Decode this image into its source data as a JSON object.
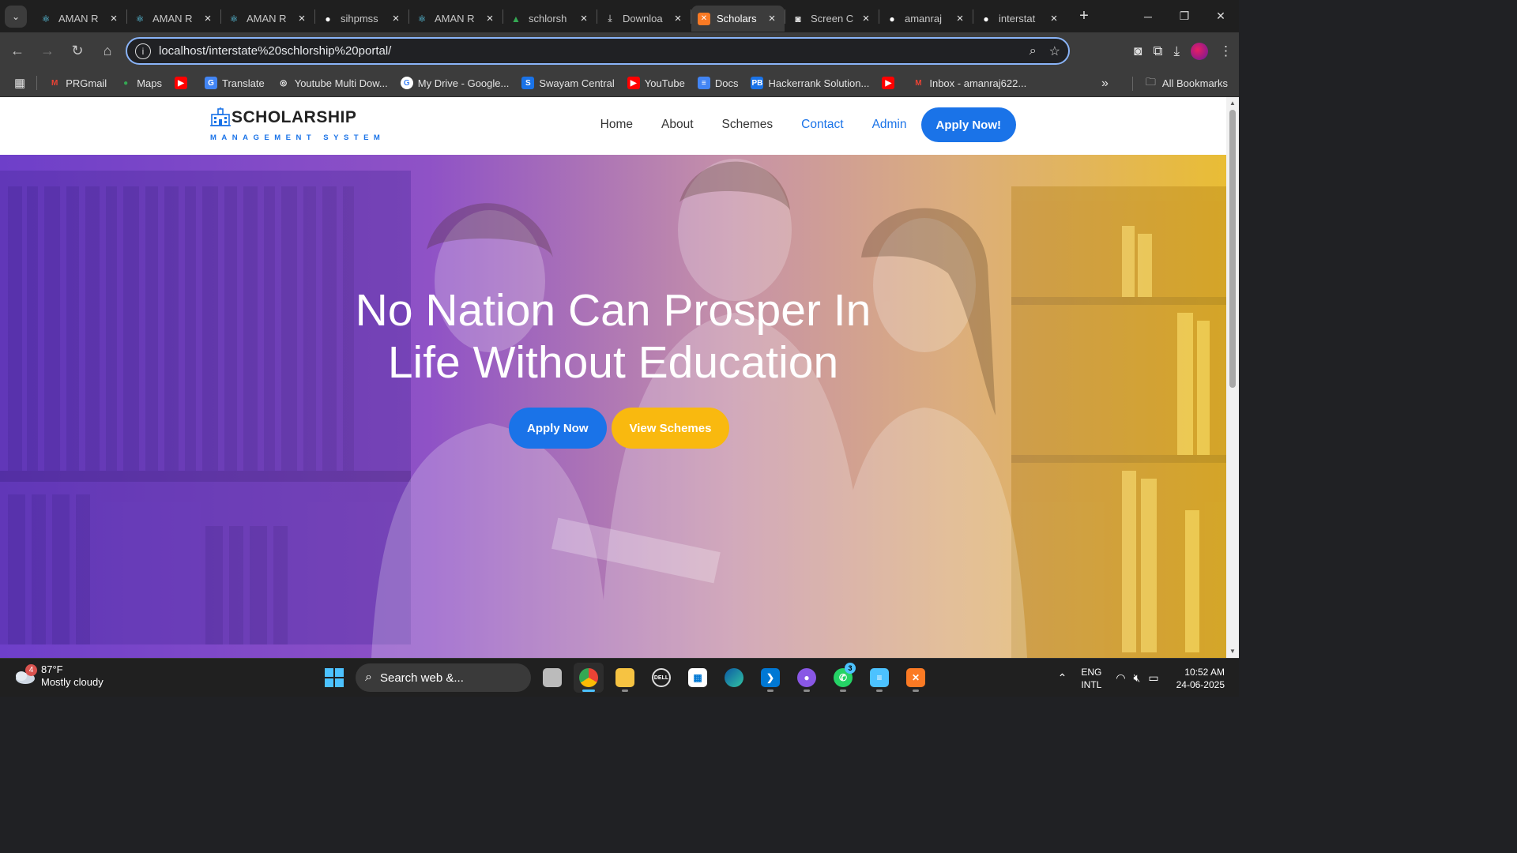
{
  "browser": {
    "tabs": [
      {
        "title": "AMAN R",
        "icon": "react-icon",
        "color": "#61dafb"
      },
      {
        "title": "AMAN R",
        "icon": "react-icon",
        "color": "#61dafb"
      },
      {
        "title": "AMAN R",
        "icon": "react-icon",
        "color": "#61dafb"
      },
      {
        "title": "sihpmss",
        "icon": "github-icon",
        "color": "#ffffff"
      },
      {
        "title": "AMAN R",
        "icon": "react-icon",
        "color": "#61dafb"
      },
      {
        "title": "schlorsh",
        "icon": "google-drive-icon",
        "color": "#34a853"
      },
      {
        "title": "Downloa",
        "icon": "download-icon",
        "color": "#e8e8e8"
      },
      {
        "title": "Scholars",
        "icon": "xampp-icon",
        "color": "#fb7a24",
        "active": true
      },
      {
        "title": "Screen C",
        "icon": "camera-icon",
        "color": "#e8e8e8"
      },
      {
        "title": "amanraj",
        "icon": "github-icon",
        "color": "#ffffff"
      },
      {
        "title": "interstat",
        "icon": "github-icon",
        "color": "#ffffff"
      }
    ],
    "url": "localhost/interstate%20schlorship%20portal/",
    "bookmarks": [
      {
        "label": "PRGmail",
        "icon": "gmail-icon",
        "color": "#ea4335",
        "glyph": "M"
      },
      {
        "label": "Maps",
        "icon": "maps-icon",
        "color": "#34a853",
        "glyph": "●"
      },
      {
        "label": "",
        "icon": "youtube-icon",
        "color": "#ff0000",
        "glyph": "▶"
      },
      {
        "label": "Translate",
        "icon": "translate-icon",
        "color": "#4285f4",
        "glyph": "G"
      },
      {
        "label": "Youtube Multi Dow...",
        "icon": "globe-icon",
        "color": "#5f6368",
        "glyph": "◎"
      },
      {
        "label": "My Drive - Google...",
        "icon": "google-icon",
        "color": "#ffffff",
        "glyph": "G"
      },
      {
        "label": "Swayam Central",
        "icon": "swayam-icon",
        "color": "#1a73e8",
        "glyph": "S"
      },
      {
        "label": "YouTube",
        "icon": "youtube-icon",
        "color": "#ff0000",
        "glyph": "▶"
      },
      {
        "label": "Docs",
        "icon": "docs-icon",
        "color": "#4285f4",
        "glyph": "≡"
      },
      {
        "label": "Hackerrank Solution...",
        "icon": "pb-icon",
        "color": "#1a73e8",
        "glyph": "PB"
      },
      {
        "label": "",
        "icon": "youtube-icon",
        "color": "#ff0000",
        "glyph": "▶"
      },
      {
        "label": "Inbox - amanraj622...",
        "icon": "gmail-icon",
        "color": "#ea4335",
        "glyph": "M"
      }
    ],
    "all_bookmarks": "All Bookmarks",
    "more_glyph": "»"
  },
  "site": {
    "logo_title": "SCHOLARSHIP",
    "logo_subtitle": "MANAGEMENT SYSTEM",
    "nav": {
      "home": "Home",
      "about": "About",
      "schemes": "Schemes",
      "contact": "Contact",
      "admin": "Admin",
      "cta": "Apply Now!"
    },
    "hero": {
      "headline_line1": "No Nation Can Prosper In",
      "headline_line2": "Life Without Education",
      "primary_button": "Apply Now",
      "secondary_button": "View Schemes"
    },
    "colors": {
      "primary": "#1a73e8",
      "secondary": "#f9b90f"
    }
  },
  "taskbar": {
    "weather_temp": "87°F",
    "weather_desc": "Mostly cloudy",
    "weather_badge": "4",
    "search_placeholder": "Search web &...",
    "whatsapp_badge": "3",
    "lang_top": "ENG",
    "lang_bottom": "INTL",
    "time": "10:52 AM",
    "date": "24-06-2025"
  }
}
